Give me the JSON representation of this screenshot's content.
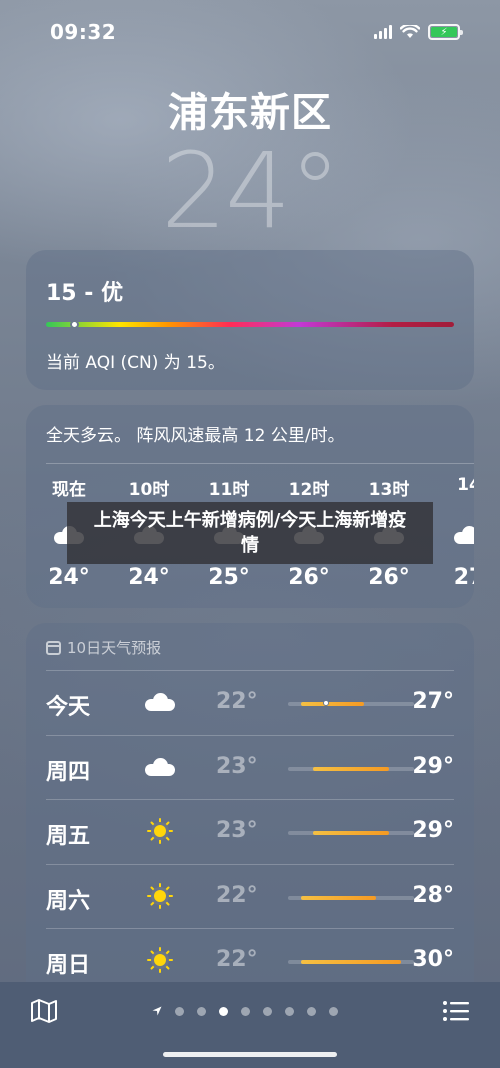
{
  "status": {
    "time": "09:32"
  },
  "location": {
    "city": "浦东新区",
    "temperature": "24°"
  },
  "aqi": {
    "headline": "15 - 优",
    "description": "当前 AQI (CN) 为 15。",
    "index_fraction": 0.03
  },
  "hourly": {
    "summary": "全天多云。 阵风风速最高 12 公里/时。",
    "items": [
      {
        "label": "现在",
        "icon": "cloud-icon",
        "temp": "24°"
      },
      {
        "label": "10时",
        "icon": "cloud-icon",
        "temp": "24°"
      },
      {
        "label": "11时",
        "icon": "cloud-icon",
        "temp": "25°"
      },
      {
        "label": "12时",
        "icon": "cloud-icon",
        "temp": "26°"
      },
      {
        "label": "13时",
        "icon": "cloud-icon",
        "temp": "26°"
      },
      {
        "label": "14",
        "icon": "cloud-icon",
        "temp": "27"
      }
    ]
  },
  "overlay": {
    "text": "上海今天上午新增病例/今天上海新增疫情"
  },
  "daily": {
    "header": "10日天气预报",
    "range_min": 21,
    "range_max": 31,
    "items": [
      {
        "day": "今天",
        "icon": "cloud-icon",
        "low": "22°",
        "high": "27°",
        "low_v": 22,
        "high_v": 27,
        "current": 24
      },
      {
        "day": "周四",
        "icon": "cloud-icon",
        "low": "23°",
        "high": "29°",
        "low_v": 23,
        "high_v": 29
      },
      {
        "day": "周五",
        "icon": "sun-icon",
        "low": "23°",
        "high": "29°",
        "low_v": 23,
        "high_v": 29
      },
      {
        "day": "周六",
        "icon": "sun-icon",
        "low": "22°",
        "high": "28°",
        "low_v": 22,
        "high_v": 28
      },
      {
        "day": "周日",
        "icon": "sun-icon",
        "low": "22°",
        "high": "30°",
        "low_v": 22,
        "high_v": 30
      }
    ]
  },
  "pager": {
    "page_count": 8,
    "active_index": 2
  },
  "colors": {
    "battery": "#34c759",
    "sun": "#ffd60a",
    "range_bar": "#f59a23"
  }
}
